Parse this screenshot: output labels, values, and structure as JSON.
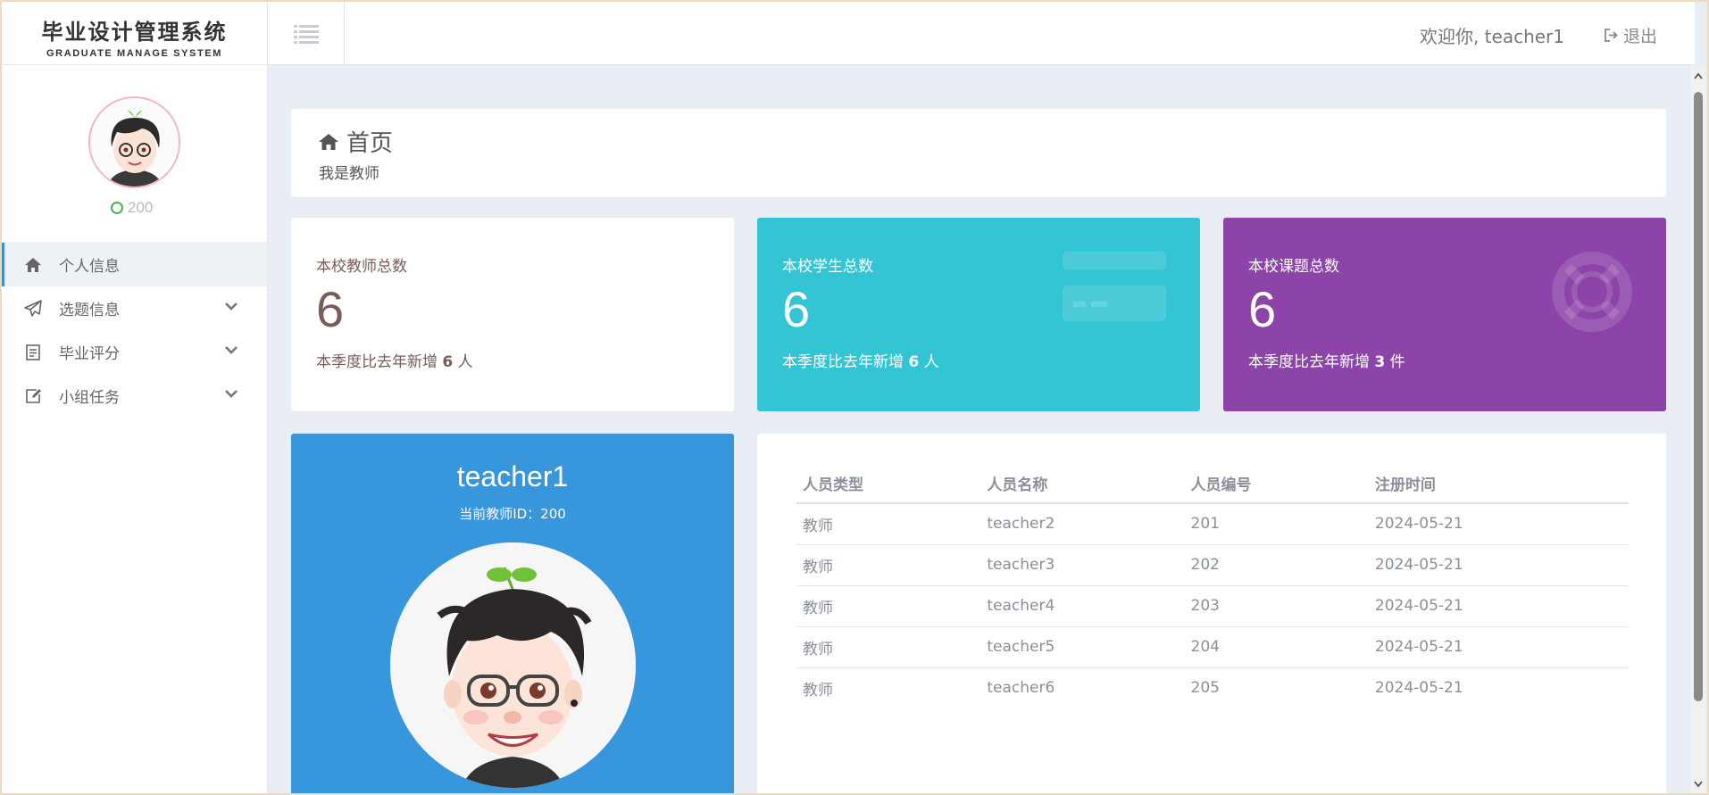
{
  "app": {
    "title_cn": "毕业设计管理系统",
    "title_en": "GRADUATE MANAGE SYSTEM"
  },
  "header": {
    "welcome": "欢迎你, teacher1",
    "logout_label": "退出"
  },
  "sidebar": {
    "status_value": "200",
    "items": [
      {
        "label": "个人信息",
        "icon": "home-icon",
        "active": true
      },
      {
        "label": "选题信息",
        "icon": "paper-plane-icon",
        "has_children": true
      },
      {
        "label": "毕业评分",
        "icon": "clipboard-icon",
        "has_children": true
      },
      {
        "label": "小组任务",
        "icon": "edit-icon",
        "has_children": true
      }
    ]
  },
  "page": {
    "title": "首页",
    "subtitle": "我是教师"
  },
  "stats": [
    {
      "label": "本校教师总数",
      "value": "6",
      "foot_prefix": "本季度比去年新增",
      "foot_value": "6",
      "foot_unit": "人",
      "color": "#ffffff"
    },
    {
      "label": "本校学生总数",
      "value": "6",
      "foot_prefix": "本季度比去年新增",
      "foot_value": "6",
      "foot_unit": "人",
      "color": "#34c5d4",
      "icon": "credit-card-icon"
    },
    {
      "label": "本校课题总数",
      "value": "6",
      "foot_prefix": "本季度比去年新增",
      "foot_value": "3",
      "foot_unit": "件",
      "color": "#8c44a9",
      "icon": "life-ring-icon"
    }
  ],
  "profile": {
    "name": "teacher1",
    "id_line": "当前教师ID：200",
    "color": "#3896dd"
  },
  "table": {
    "headers": [
      "人员类型",
      "人员名称",
      "人员编号",
      "注册时间"
    ],
    "rows": [
      [
        "教师",
        "teacher2",
        "201",
        "2024-05-21"
      ],
      [
        "教师",
        "teacher3",
        "202",
        "2024-05-21"
      ],
      [
        "教师",
        "teacher4",
        "203",
        "2024-05-21"
      ],
      [
        "教师",
        "teacher5",
        "204",
        "2024-05-21"
      ],
      [
        "教师",
        "teacher6",
        "205",
        "2024-05-21"
      ]
    ]
  }
}
